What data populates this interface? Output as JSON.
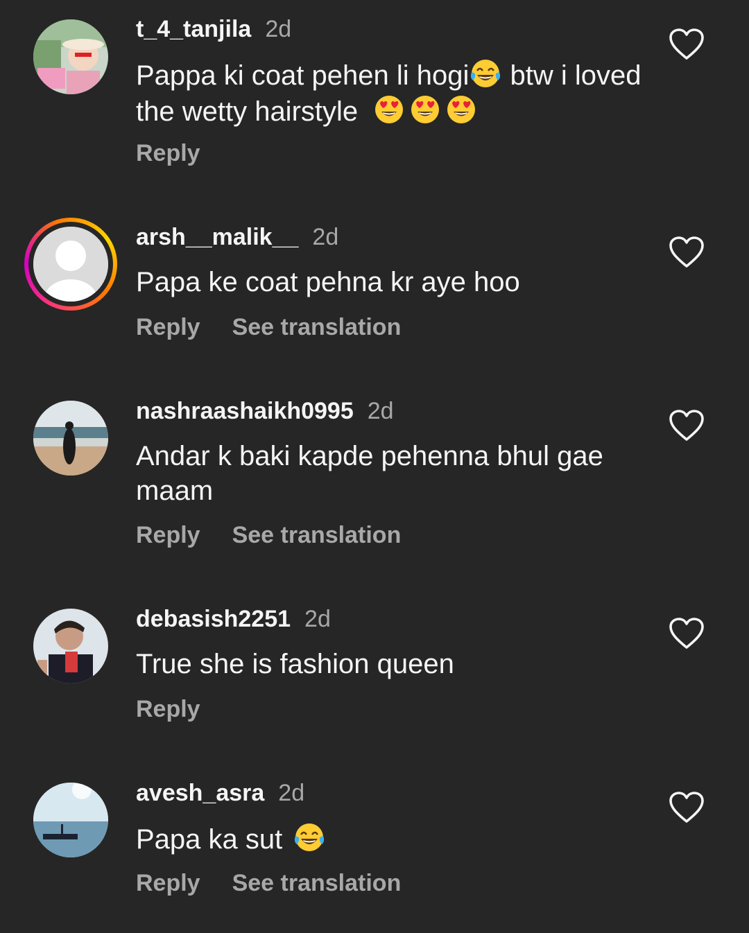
{
  "comments": [
    {
      "username": "t_4_tanjila",
      "time": "2d",
      "text": "Pappa ki coat pehen li hogi",
      "text_after": " btw i loved the wetty hairstyle",
      "emoji_inline": "face-with-tears-of-joy-icon",
      "emoji_trailing": [
        "smiling-face-with-heart-eyes-icon",
        "smiling-face-with-heart-eyes-icon",
        "smiling-face-with-heart-eyes-icon"
      ],
      "reply": "Reply"
    },
    {
      "username": "arsh__malik__",
      "time": "2d",
      "text": "Papa ke coat pehna kr aye hoo",
      "reply": "Reply",
      "see_translation": "See translation"
    },
    {
      "username": "nashraashaikh0995",
      "time": "2d",
      "text": "Andar k baki kapde pehenna bhul gae maam",
      "reply": "Reply",
      "see_translation": "See translation"
    },
    {
      "username": "debasish2251",
      "time": "2d",
      "text": "True she is fashion queen",
      "reply": "Reply"
    },
    {
      "username": "avesh_asra",
      "time": "2d",
      "text": "Papa ka sut ",
      "emoji_trailing": [
        "face-with-tears-of-joy-icon"
      ],
      "reply": "Reply",
      "see_translation": "See translation"
    }
  ],
  "colors": {
    "background": "#262626",
    "text_primary": "#f5f5f5",
    "text_secondary": "#a8a8a8",
    "story_ring": "#d300c5"
  }
}
